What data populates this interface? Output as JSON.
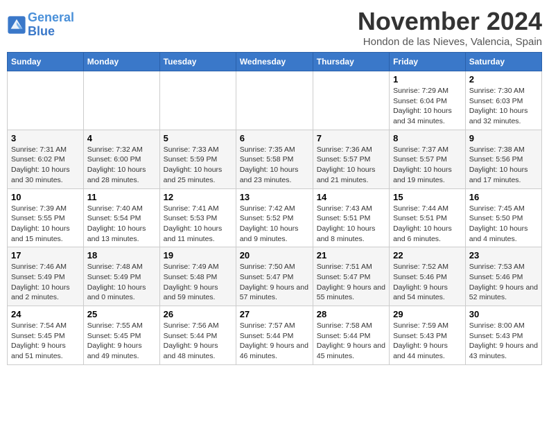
{
  "header": {
    "logo_line1": "General",
    "logo_line2": "Blue",
    "month_title": "November 2024",
    "location": "Hondon de las Nieves, Valencia, Spain"
  },
  "days_of_week": [
    "Sunday",
    "Monday",
    "Tuesday",
    "Wednesday",
    "Thursday",
    "Friday",
    "Saturday"
  ],
  "weeks": [
    [
      {
        "day": "",
        "info": ""
      },
      {
        "day": "",
        "info": ""
      },
      {
        "day": "",
        "info": ""
      },
      {
        "day": "",
        "info": ""
      },
      {
        "day": "",
        "info": ""
      },
      {
        "day": "1",
        "info": "Sunrise: 7:29 AM\nSunset: 6:04 PM\nDaylight: 10 hours and 34 minutes."
      },
      {
        "day": "2",
        "info": "Sunrise: 7:30 AM\nSunset: 6:03 PM\nDaylight: 10 hours and 32 minutes."
      }
    ],
    [
      {
        "day": "3",
        "info": "Sunrise: 7:31 AM\nSunset: 6:02 PM\nDaylight: 10 hours and 30 minutes."
      },
      {
        "day": "4",
        "info": "Sunrise: 7:32 AM\nSunset: 6:00 PM\nDaylight: 10 hours and 28 minutes."
      },
      {
        "day": "5",
        "info": "Sunrise: 7:33 AM\nSunset: 5:59 PM\nDaylight: 10 hours and 25 minutes."
      },
      {
        "day": "6",
        "info": "Sunrise: 7:35 AM\nSunset: 5:58 PM\nDaylight: 10 hours and 23 minutes."
      },
      {
        "day": "7",
        "info": "Sunrise: 7:36 AM\nSunset: 5:57 PM\nDaylight: 10 hours and 21 minutes."
      },
      {
        "day": "8",
        "info": "Sunrise: 7:37 AM\nSunset: 5:57 PM\nDaylight: 10 hours and 19 minutes."
      },
      {
        "day": "9",
        "info": "Sunrise: 7:38 AM\nSunset: 5:56 PM\nDaylight: 10 hours and 17 minutes."
      }
    ],
    [
      {
        "day": "10",
        "info": "Sunrise: 7:39 AM\nSunset: 5:55 PM\nDaylight: 10 hours and 15 minutes."
      },
      {
        "day": "11",
        "info": "Sunrise: 7:40 AM\nSunset: 5:54 PM\nDaylight: 10 hours and 13 minutes."
      },
      {
        "day": "12",
        "info": "Sunrise: 7:41 AM\nSunset: 5:53 PM\nDaylight: 10 hours and 11 minutes."
      },
      {
        "day": "13",
        "info": "Sunrise: 7:42 AM\nSunset: 5:52 PM\nDaylight: 10 hours and 9 minutes."
      },
      {
        "day": "14",
        "info": "Sunrise: 7:43 AM\nSunset: 5:51 PM\nDaylight: 10 hours and 8 minutes."
      },
      {
        "day": "15",
        "info": "Sunrise: 7:44 AM\nSunset: 5:51 PM\nDaylight: 10 hours and 6 minutes."
      },
      {
        "day": "16",
        "info": "Sunrise: 7:45 AM\nSunset: 5:50 PM\nDaylight: 10 hours and 4 minutes."
      }
    ],
    [
      {
        "day": "17",
        "info": "Sunrise: 7:46 AM\nSunset: 5:49 PM\nDaylight: 10 hours and 2 minutes."
      },
      {
        "day": "18",
        "info": "Sunrise: 7:48 AM\nSunset: 5:49 PM\nDaylight: 10 hours and 0 minutes."
      },
      {
        "day": "19",
        "info": "Sunrise: 7:49 AM\nSunset: 5:48 PM\nDaylight: 9 hours and 59 minutes."
      },
      {
        "day": "20",
        "info": "Sunrise: 7:50 AM\nSunset: 5:47 PM\nDaylight: 9 hours and 57 minutes."
      },
      {
        "day": "21",
        "info": "Sunrise: 7:51 AM\nSunset: 5:47 PM\nDaylight: 9 hours and 55 minutes."
      },
      {
        "day": "22",
        "info": "Sunrise: 7:52 AM\nSunset: 5:46 PM\nDaylight: 9 hours and 54 minutes."
      },
      {
        "day": "23",
        "info": "Sunrise: 7:53 AM\nSunset: 5:46 PM\nDaylight: 9 hours and 52 minutes."
      }
    ],
    [
      {
        "day": "24",
        "info": "Sunrise: 7:54 AM\nSunset: 5:45 PM\nDaylight: 9 hours and 51 minutes."
      },
      {
        "day": "25",
        "info": "Sunrise: 7:55 AM\nSunset: 5:45 PM\nDaylight: 9 hours and 49 minutes."
      },
      {
        "day": "26",
        "info": "Sunrise: 7:56 AM\nSunset: 5:44 PM\nDaylight: 9 hours and 48 minutes."
      },
      {
        "day": "27",
        "info": "Sunrise: 7:57 AM\nSunset: 5:44 PM\nDaylight: 9 hours and 46 minutes."
      },
      {
        "day": "28",
        "info": "Sunrise: 7:58 AM\nSunset: 5:44 PM\nDaylight: 9 hours and 45 minutes."
      },
      {
        "day": "29",
        "info": "Sunrise: 7:59 AM\nSunset: 5:43 PM\nDaylight: 9 hours and 44 minutes."
      },
      {
        "day": "30",
        "info": "Sunrise: 8:00 AM\nSunset: 5:43 PM\nDaylight: 9 hours and 43 minutes."
      }
    ]
  ]
}
